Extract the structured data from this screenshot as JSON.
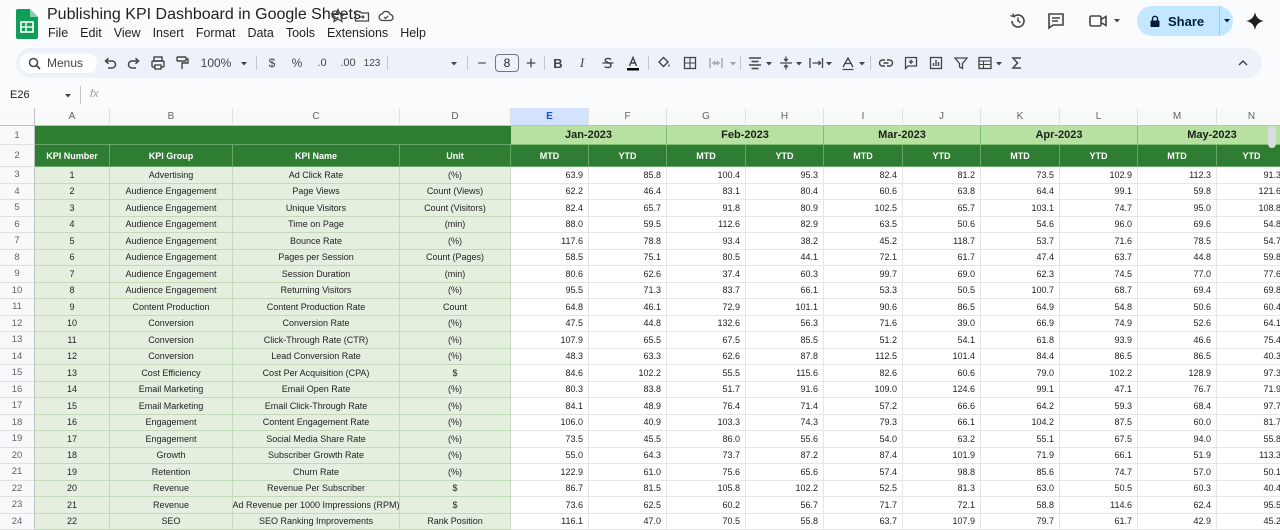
{
  "app": {
    "doc_title": "Publishing KPI Dashboard in Google Sheets",
    "menu": [
      "File",
      "Edit",
      "View",
      "Insert",
      "Format",
      "Data",
      "Tools",
      "Extensions",
      "Help"
    ],
    "share_label": "Share",
    "accent_color": "#c2e7ff"
  },
  "toolbar": {
    "menus_label": "Menus",
    "zoom": "100%",
    "currency": "$",
    "percent": "%",
    "dec_decrease": ".0",
    "dec_increase": ".00",
    "number_format": "123",
    "font_size": "8",
    "bold": "B",
    "italic": "I"
  },
  "formula_bar": {
    "name_box": "E26",
    "fx": "fx"
  },
  "grid": {
    "columns": [
      "A",
      "B",
      "C",
      "D",
      "E",
      "F",
      "G",
      "H",
      "I",
      "J",
      "K",
      "L",
      "M",
      "N"
    ],
    "selected_column": "E",
    "months": [
      "Jan-2023",
      "Feb-2023",
      "Mar-2023",
      "Apr-2023",
      "May-2023"
    ],
    "sub_headers": [
      "MTD",
      "YTD"
    ],
    "header_labels": [
      "KPI Number",
      "KPI Group",
      "KPI Name",
      "Unit"
    ],
    "rows": [
      {
        "n": "1",
        "group": "Advertising",
        "name": "Ad Click Rate",
        "unit": "(%)",
        "vals": [
          "63.9",
          "85.8",
          "100.4",
          "95.3",
          "82.4",
          "81.2",
          "73.5",
          "102.9",
          "112.3",
          "91.3"
        ]
      },
      {
        "n": "2",
        "group": "Audience Engagement",
        "name": "Page Views",
        "unit": "Count (Views)",
        "vals": [
          "62.2",
          "46.4",
          "83.1",
          "80.4",
          "60.6",
          "63.8",
          "64.4",
          "99.1",
          "59.8",
          "121.6"
        ]
      },
      {
        "n": "3",
        "group": "Audience Engagement",
        "name": "Unique Visitors",
        "unit": "Count (Visitors)",
        "vals": [
          "82.4",
          "65.7",
          "91.8",
          "80.9",
          "102.5",
          "65.7",
          "103.1",
          "74.7",
          "95.0",
          "108.8"
        ]
      },
      {
        "n": "4",
        "group": "Audience Engagement",
        "name": "Time on Page",
        "unit": "(min)",
        "vals": [
          "88.0",
          "59.5",
          "112.6",
          "82.9",
          "63.5",
          "50.6",
          "54.6",
          "96.0",
          "69.6",
          "54.8"
        ]
      },
      {
        "n": "5",
        "group": "Audience Engagement",
        "name": "Bounce Rate",
        "unit": "(%)",
        "vals": [
          "117.6",
          "78.8",
          "93.4",
          "38.2",
          "45.2",
          "118.7",
          "53.7",
          "71.6",
          "78.5",
          "54.7"
        ]
      },
      {
        "n": "6",
        "group": "Audience Engagement",
        "name": "Pages per Session",
        "unit": "Count (Pages)",
        "vals": [
          "58.5",
          "75.1",
          "80.5",
          "44.1",
          "72.1",
          "61.7",
          "47.4",
          "63.7",
          "44.8",
          "59.8"
        ]
      },
      {
        "n": "7",
        "group": "Audience Engagement",
        "name": "Session Duration",
        "unit": "(min)",
        "vals": [
          "80.6",
          "62.6",
          "37.4",
          "60.3",
          "99.7",
          "69.0",
          "62.3",
          "74.5",
          "77.0",
          "77.6"
        ]
      },
      {
        "n": "8",
        "group": "Audience Engagement",
        "name": "Returning Visitors",
        "unit": "(%)",
        "vals": [
          "95.5",
          "71.3",
          "83.7",
          "66.1",
          "53.3",
          "50.5",
          "100.7",
          "68.7",
          "69.4",
          "69.8"
        ]
      },
      {
        "n": "9",
        "group": "Content Production",
        "name": "Content Production Rate",
        "unit": "Count",
        "vals": [
          "64.8",
          "46.1",
          "72.9",
          "101.1",
          "90.6",
          "86.5",
          "64.9",
          "54.8",
          "50.6",
          "60.4"
        ]
      },
      {
        "n": "10",
        "group": "Conversion",
        "name": "Conversion Rate",
        "unit": "(%)",
        "vals": [
          "47.5",
          "44.8",
          "132.6",
          "56.3",
          "71.6",
          "39.0",
          "66.9",
          "74.9",
          "52.6",
          "64.1"
        ]
      },
      {
        "n": "11",
        "group": "Conversion",
        "name": "Click-Through Rate (CTR)",
        "unit": "(%)",
        "vals": [
          "107.9",
          "65.5",
          "67.5",
          "85.5",
          "51.2",
          "54.1",
          "61.8",
          "93.9",
          "46.6",
          "75.4"
        ]
      },
      {
        "n": "12",
        "group": "Conversion",
        "name": "Lead Conversion Rate",
        "unit": "(%)",
        "vals": [
          "48.3",
          "63.3",
          "62.6",
          "87.8",
          "112.5",
          "101.4",
          "84.4",
          "86.5",
          "86.5",
          "40.3"
        ]
      },
      {
        "n": "13",
        "group": "Cost Efficiency",
        "name": "Cost Per Acquisition (CPA)",
        "unit": "$",
        "vals": [
          "84.6",
          "102.2",
          "55.5",
          "115.6",
          "82.6",
          "60.6",
          "79.0",
          "102.2",
          "128.9",
          "97.3"
        ]
      },
      {
        "n": "14",
        "group": "Email Marketing",
        "name": "Email Open Rate",
        "unit": "(%)",
        "vals": [
          "80.3",
          "83.8",
          "51.7",
          "91.6",
          "109.0",
          "124.6",
          "99.1",
          "47.1",
          "76.7",
          "71.9"
        ]
      },
      {
        "n": "15",
        "group": "Email Marketing",
        "name": "Email Click-Through Rate",
        "unit": "(%)",
        "vals": [
          "84.1",
          "48.9",
          "76.4",
          "71.4",
          "57.2",
          "66.6",
          "64.2",
          "59.3",
          "68.4",
          "97.7"
        ]
      },
      {
        "n": "16",
        "group": "Engagement",
        "name": "Content Engagement Rate",
        "unit": "(%)",
        "vals": [
          "106.0",
          "40.9",
          "103.3",
          "74.3",
          "79.3",
          "66.1",
          "104.2",
          "87.5",
          "60.0",
          "81.7"
        ]
      },
      {
        "n": "17",
        "group": "Engagement",
        "name": "Social Media Share Rate",
        "unit": "(%)",
        "vals": [
          "73.5",
          "45.5",
          "86.0",
          "55.6",
          "54.0",
          "63.2",
          "55.1",
          "67.5",
          "94.0",
          "55.8"
        ]
      },
      {
        "n": "18",
        "group": "Growth",
        "name": "Subscriber Growth Rate",
        "unit": "(%)",
        "vals": [
          "55.0",
          "64.3",
          "73.7",
          "87.2",
          "87.4",
          "101.9",
          "71.9",
          "66.1",
          "51.9",
          "113.3"
        ]
      },
      {
        "n": "19",
        "group": "Retention",
        "name": "Churn Rate",
        "unit": "(%)",
        "vals": [
          "122.9",
          "61.0",
          "75.6",
          "65.6",
          "57.4",
          "98.8",
          "85.6",
          "74.7",
          "57.0",
          "50.1"
        ]
      },
      {
        "n": "20",
        "group": "Revenue",
        "name": "Revenue Per Subscriber",
        "unit": "$",
        "vals": [
          "86.7",
          "81.5",
          "105.8",
          "102.2",
          "52.5",
          "81.3",
          "63.0",
          "50.5",
          "60.3",
          "40.4"
        ]
      },
      {
        "n": "21",
        "group": "Revenue",
        "name": "Ad Revenue per 1000 Impressions (RPM)",
        "unit": "$",
        "vals": [
          "73.6",
          "62.5",
          "60.2",
          "56.7",
          "71.7",
          "72.1",
          "58.8",
          "114.6",
          "62.4",
          "95.5"
        ]
      },
      {
        "n": "22",
        "group": "SEO",
        "name": "SEO Ranking Improvements",
        "unit": "Rank Position",
        "vals": [
          "116.1",
          "47.0",
          "70.5",
          "55.8",
          "63.7",
          "107.9",
          "79.7",
          "61.7",
          "42.9",
          "45.2"
        ]
      }
    ]
  }
}
